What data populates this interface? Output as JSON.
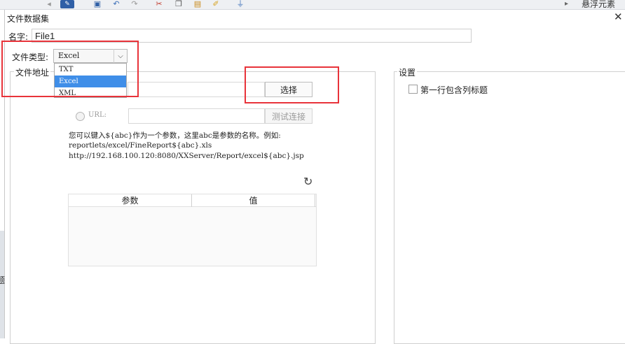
{
  "background_app": {
    "right_label": "悬浮元素",
    "left_partial_char": "题"
  },
  "dialog": {
    "title": "文件数据集",
    "close_symbol": "✕",
    "name_label": "名字:",
    "name_value": "File1",
    "file_type_label": "文件类型:",
    "file_type_selected": "Excel",
    "file_type_options": [
      "TXT",
      "Excel",
      "XML"
    ],
    "file_address_label": "文件地址",
    "choose_button": "选择",
    "url_label": "URL:",
    "test_connection_button": "测试连接",
    "hint_lines": [
      "您可以键入${abc}作为一个参数，这里abc是参数的名称。例如:",
      "reportlets/excel/FineReport${abc}.xls",
      "http://192.168.100.120:8080/XXServer/Report/excel${abc}.jsp"
    ],
    "param_table": {
      "headers": [
        "参数",
        "值"
      ],
      "rows": []
    },
    "settings": {
      "label": "设置",
      "first_row_header_label": "第一行包含列标题",
      "first_row_header_checked": false
    }
  },
  "icons": [
    "save-icon",
    "undo-icon",
    "redo-icon",
    "cut-icon",
    "copy-icon",
    "paste-icon",
    "format-brush-icon",
    "plug-icon",
    "refresh-icon",
    "chevron-down-icon",
    "close-icon"
  ],
  "colors": {
    "annotation": "#e8333a",
    "selection": "#3f8ee8"
  }
}
